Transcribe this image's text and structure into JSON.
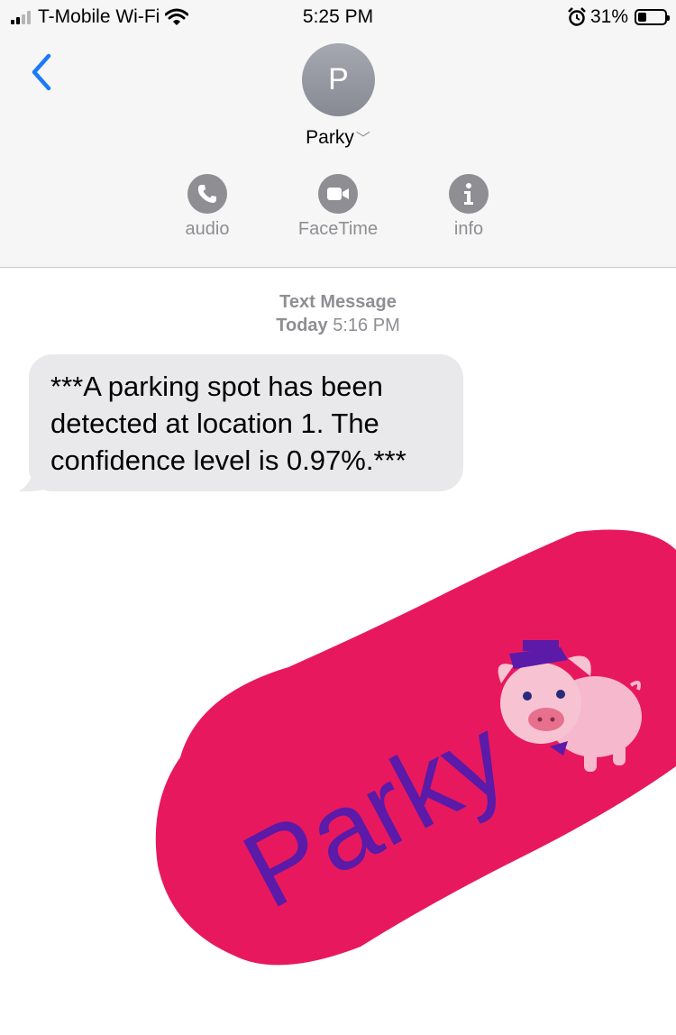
{
  "status_bar": {
    "carrier": "T-Mobile Wi-Fi",
    "time": "5:25 PM",
    "battery": "31%",
    "battery_level": 0.31
  },
  "conversation": {
    "avatar_letter": "P",
    "contact_name": "Parky",
    "actions": [
      {
        "label": "audio",
        "icon": "phone-icon"
      },
      {
        "label": "FaceTime",
        "icon": "video-camera-icon"
      },
      {
        "label": "info",
        "icon": "info-icon"
      }
    ]
  },
  "thread": {
    "service": "Text Message",
    "day": "Today",
    "time": "5:16 PM",
    "messages": [
      {
        "text": "***A parking spot has been detected at location 1. The confidence level is 0.97%.***",
        "direction": "incoming"
      }
    ]
  },
  "sticker": {
    "text": "Parky",
    "description": "pig-mascot-logo"
  },
  "colors": {
    "accent": "#1a7cf5",
    "sticker_background": "#e8185f",
    "sticker_text": "#5b1aa8",
    "bubble_incoming": "#e9e9eb",
    "secondary_text": "#8e8e93"
  }
}
